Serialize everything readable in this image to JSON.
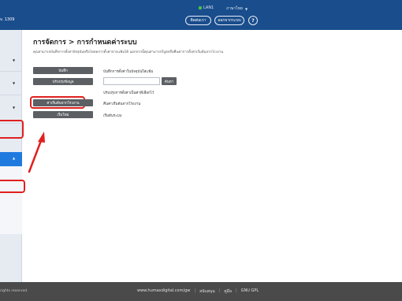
{
  "header": {
    "version": "v. 1309",
    "lan_status": "LAN1",
    "language": "ภาษาไทย",
    "logout_label": "ติดต่อเรา",
    "contact_label": "ออกจากระบบ",
    "help_label": "?"
  },
  "page": {
    "title": "การจัดการ > การกำหนดค่าระบบ",
    "description": "คุณสามารถบันทึกการตั้งค่าปัจจุบันหรือโหลดการตั้งค่าจากแฟ้มได้ นอกจากนี้คุณสามารถรีบูตหรือคืนค่าการตั้งค่าเริ่มต้นจากโรงงาน"
  },
  "actions": [
    {
      "button": "บันทึก",
      "label": "บันทึกการตั้งค่าในปัจจุบันใส่แฟ้ม"
    },
    {
      "button": "ปรับปรุงข้อมูล",
      "label": "ปรับปรุงการตั้งค่าเป็นค่าที่เลือกไว้"
    },
    {
      "button": "ค่าเริ่มต้นจากโรงงาน",
      "label": "คืนค่าเริ่มต้นจากโรงงาน"
    },
    {
      "button": "เริ่มใหม่",
      "label": "เริ่มต้นระบบ"
    }
  ],
  "browse_label": "ค้นหา",
  "footer": {
    "rights": "rights reserved.",
    "site": "www.humaxdigital.com/gw",
    "support": "สนับสนุน",
    "manual": "คู่มือ",
    "license": "GNU GPL"
  },
  "colors": {
    "header_bg": "#1a4d8c",
    "sidebar_active": "#1f7ae0",
    "highlight": "#e0201f",
    "button_bg": "#5c5f63",
    "footer_bg": "#4a4a4a"
  },
  "icons": [
    "sidebar-caret-down-icon",
    "sidebar-caret-up-icon",
    "lan-status-icon",
    "language-caret-icon",
    "help-icon"
  ]
}
